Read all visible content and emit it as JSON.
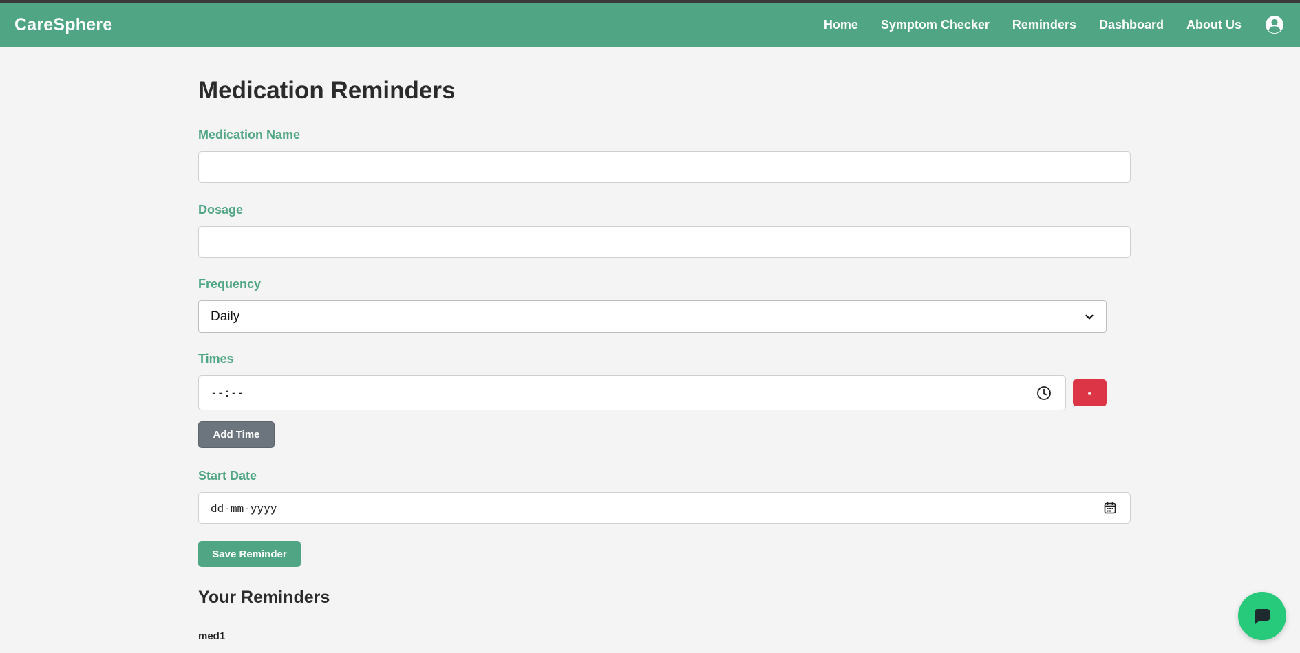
{
  "app": {
    "brand": "CareSphere"
  },
  "nav": {
    "links": [
      "Home",
      "Symptom Checker",
      "Reminders",
      "Dashboard",
      "About Us"
    ]
  },
  "form": {
    "title": "Medication Reminders",
    "medication_name": {
      "label": "Medication Name",
      "value": ""
    },
    "dosage": {
      "label": "Dosage",
      "value": ""
    },
    "frequency": {
      "label": "Frequency",
      "selected": "Daily"
    },
    "times": {
      "label": "Times",
      "value": "--:--",
      "remove_label": "-",
      "add_label": "Add Time"
    },
    "start_date": {
      "label": "Start Date",
      "value": "dd-mm-yyyy"
    },
    "save_label": "Save Reminder"
  },
  "reminders": {
    "title": "Your Reminders",
    "items": [
      "med1"
    ]
  },
  "colors": {
    "primary": "#50a684",
    "danger": "#dc3545",
    "secondary": "#6c757d",
    "chat": "#27c97a"
  },
  "icons": {
    "profile": "user-circle-icon",
    "clock": "clock-icon",
    "calendar": "calendar-icon",
    "chevron": "chevron-down-icon",
    "chat": "chat-bubble-icon"
  }
}
